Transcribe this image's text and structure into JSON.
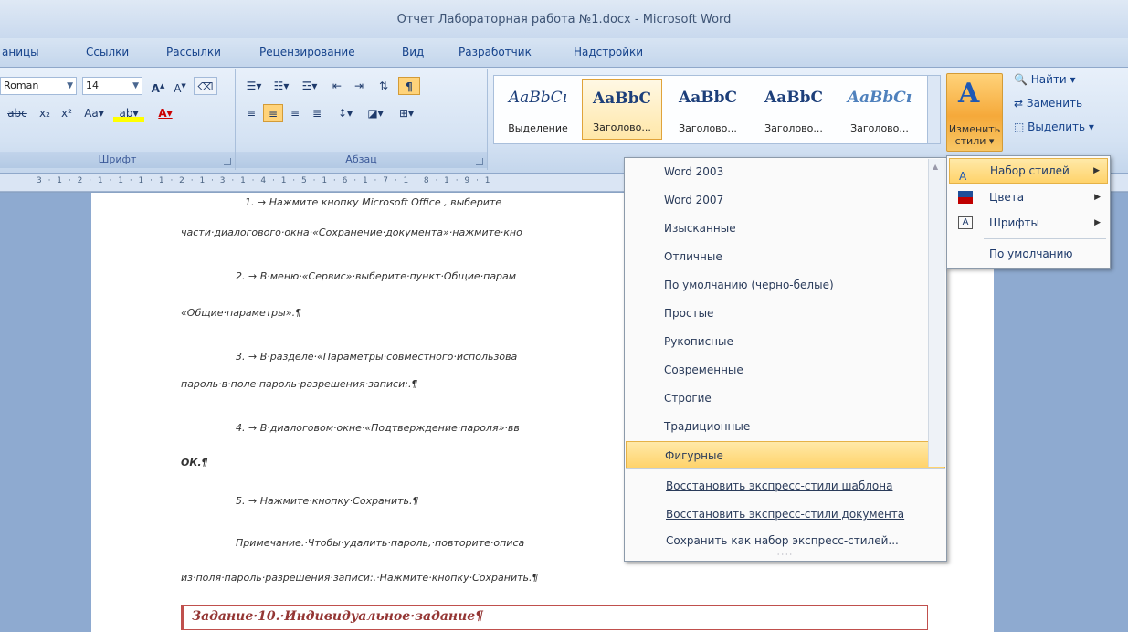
{
  "window": {
    "title": "Отчет Лабораторная работа №1.docx - Microsoft Word"
  },
  "tabs": [
    "аницы",
    "Ссылки",
    "Рассылки",
    "Рецензирование",
    "Вид",
    "Разработчик",
    "Надстройки"
  ],
  "ribbon": {
    "font": {
      "name": "Roman",
      "size": "14",
      "group_label": "Шрифт"
    },
    "paragraph": {
      "group_label": "Абзац"
    },
    "styles": {
      "items": [
        {
          "sample": "AaBbCı",
          "label": "Выделение"
        },
        {
          "sample": "AaBbC",
          "label": "Заголово..."
        },
        {
          "sample": "AaBbC",
          "label": "Заголово..."
        },
        {
          "sample": "AaBbC",
          "label": "Заголово..."
        },
        {
          "sample": "AaBbCı",
          "label": "Заголово..."
        }
      ],
      "change_label_1": "Изменить",
      "change_label_2": "стили ▾"
    },
    "editing": {
      "find": "Найти ▾",
      "replace": "Заменить",
      "select": "Выделить ▾"
    }
  },
  "ruler": {
    "marks": "3 · 1 · 2 · 1 · 1 · 1 · 1 · 2 · 1 · 3 · 1 · 4 · 1 · 5 · 1 · 6 · 1 · 7 · 1 · 8 · 1 · 9 · 1"
  },
  "document": {
    "lines": [
      "1.  →  Нажмите кнопку Microsoft Office , выберите",
      "части·диалогового·окна·«Сохранение·документа»·нажмите·кно",
      "2.  →  В·меню·«Сервис»·выберите·пункт·Общие·парам",
      "«Общие·параметры».¶",
      "3.  →  В·разделе·«Параметры·совместного·использова",
      "пароль·в·поле·пароль·разрешения·записи:.¶",
      "4.  →  В·диалоговом·окне·«Подтверждение·пароля»·вв",
      "ОК.¶",
      "5.  →  Нажмите·кнопку·Сохранить.¶",
      "Примечание.·Чтобы·удалить·пароль,·повторите·описа",
      "из·поля·пароль·разрешения·записи:.·Нажмите·кнопку·Сохранить.¶"
    ],
    "task_heading": "Задание·10.·Индивидуальное·задание¶"
  },
  "style_sets_menu": {
    "items": [
      "Word 2003",
      "Word 2007",
      "Изысканные",
      "Отличные",
      "По умолчанию (черно-белые)",
      "Простые",
      "Рукописные",
      "Современные",
      "Строгие",
      "Традиционные",
      "Фигурные"
    ],
    "highlighted": "Фигурные",
    "actions": [
      "Восстановить экспресс-стили шаблона",
      "Восстановить экспресс-стили документа",
      "Сохранить как набор экспресс-стилей..."
    ]
  },
  "change_styles_menu": {
    "items": [
      {
        "label": "Набор стилей",
        "icon": "style-set-icon",
        "has_submenu": true
      },
      {
        "label": "Цвета",
        "icon": "colors-icon",
        "has_submenu": true
      },
      {
        "label": "Шрифты",
        "icon": "fonts-icon",
        "has_submenu": true
      },
      {
        "label": "По умолчанию",
        "icon": "",
        "has_submenu": false
      }
    ]
  },
  "colors": {
    "accent_highlight": "#ffd36b",
    "heading_red": "#c0504d"
  }
}
